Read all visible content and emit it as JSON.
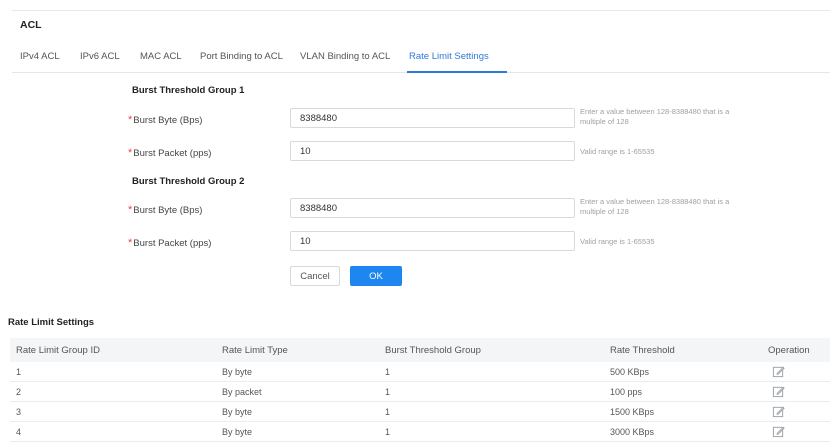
{
  "page": {
    "title": "ACL"
  },
  "tabs": [
    {
      "label": "IPv4 ACL",
      "active": false
    },
    {
      "label": "IPv6 ACL",
      "active": false
    },
    {
      "label": "MAC ACL",
      "active": false
    },
    {
      "label": "Port Binding to ACL",
      "active": false
    },
    {
      "label": "VLAN Binding to ACL",
      "active": false
    },
    {
      "label": "Rate Limit Settings",
      "active": true
    }
  ],
  "form": {
    "groups": [
      {
        "title": "Burst Threshold Group 1",
        "fields": [
          {
            "required_mark": "*",
            "label": "Burst Byte (Bps)",
            "value": "8388480",
            "hint": "Enter a value between 128-8388480 that is a multiple of 128"
          },
          {
            "required_mark": "*",
            "label": "Burst Packet (pps)",
            "value": "10",
            "hint": "Valid range is 1-65535"
          }
        ]
      },
      {
        "title": "Burst Threshold Group 2",
        "fields": [
          {
            "required_mark": "*",
            "label": "Burst Byte (Bps)",
            "value": "8388480",
            "hint": "Enter a value between 128-8388480 that is a multiple of 128"
          },
          {
            "required_mark": "*",
            "label": "Burst Packet (pps)",
            "value": "10",
            "hint": "Valid range is 1-65535"
          }
        ]
      }
    ],
    "buttons": {
      "cancel": "Cancel",
      "ok": "OK"
    }
  },
  "table": {
    "title": "Rate Limit Settings",
    "columns": [
      "Rate Limit Group ID",
      "Rate Limit Type",
      "Burst Threshold Group",
      "Rate Threshold",
      "Operation"
    ],
    "rows": [
      [
        "1",
        "By byte",
        "1",
        "500 KBps"
      ],
      [
        "2",
        "By packet",
        "1",
        "100 pps"
      ],
      [
        "3",
        "By byte",
        "1",
        "1500 KBps"
      ],
      [
        "4",
        "By byte",
        "1",
        "3000 KBps"
      ]
    ],
    "operation_icon": "edit-icon"
  },
  "colors": {
    "accent": "#2f7ad9",
    "primary_button": "#1d86f0",
    "required": "#e5484d",
    "header_bg": "#f4f5f7"
  }
}
